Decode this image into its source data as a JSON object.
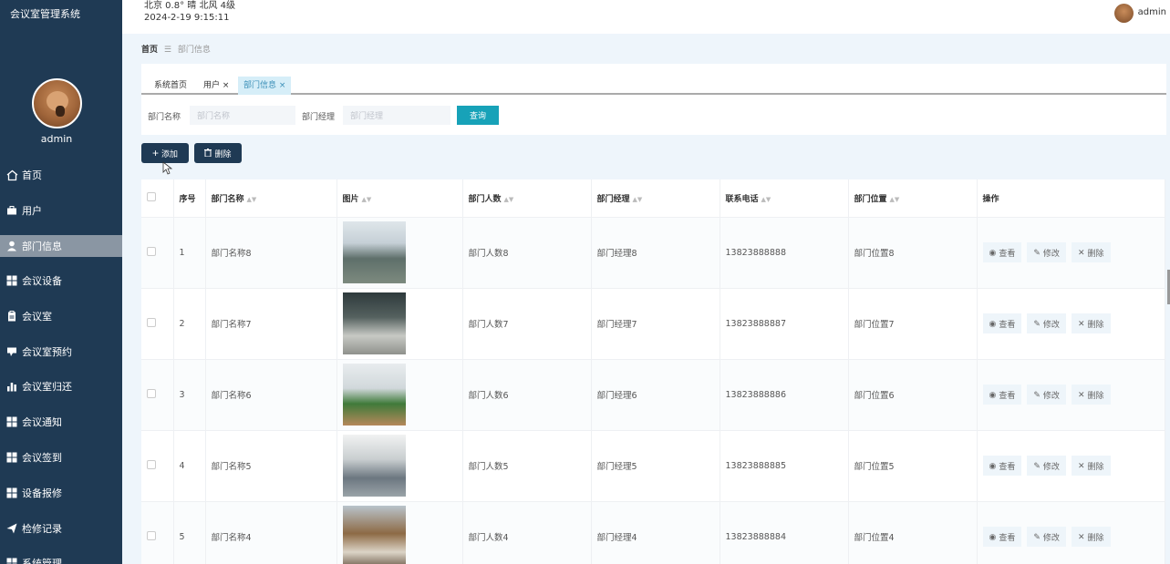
{
  "app": {
    "title": "会议室管理系统"
  },
  "sidebar": {
    "username": "admin",
    "items": [
      {
        "label": "首页",
        "icon": "home-icon"
      },
      {
        "label": "用户",
        "icon": "briefcase-icon"
      },
      {
        "label": "部门信息",
        "icon": "user-icon",
        "active": true
      },
      {
        "label": "会议设备",
        "icon": "grid-icon"
      },
      {
        "label": "会议室",
        "icon": "clipboard-icon"
      },
      {
        "label": "会议室预约",
        "icon": "comment-icon"
      },
      {
        "label": "会议室归还",
        "icon": "bar-chart-icon"
      },
      {
        "label": "会议通知",
        "icon": "grid-icon"
      },
      {
        "label": "会议签到",
        "icon": "grid-icon"
      },
      {
        "label": "设备报修",
        "icon": "grid-icon"
      },
      {
        "label": "检修记录",
        "icon": "send-icon"
      },
      {
        "label": "系统管理",
        "icon": "grid-icon"
      }
    ]
  },
  "topbar": {
    "weather_line": "北京  0.8°  晴  北风  4级",
    "datetime": "2024-2-19 9:15:11",
    "username": "admin"
  },
  "breadcrumb": {
    "home": "首页",
    "separator": "☰",
    "current": "部门信息"
  },
  "tabs": [
    {
      "label": "系统首页",
      "closable": false,
      "active": false
    },
    {
      "label": "用户",
      "closable": true,
      "active": false
    },
    {
      "label": "部门信息",
      "closable": true,
      "active": true
    }
  ],
  "tab_close_glyph": "×",
  "search": {
    "dept_name_label": "部门名称",
    "dept_name_placeholder": "部门名称",
    "dept_manager_label": "部门经理",
    "dept_manager_placeholder": "部门经理",
    "query_button": "查询"
  },
  "actions": {
    "add": "添加",
    "delete": "删除"
  },
  "table": {
    "columns": [
      "",
      "序号",
      "部门名称",
      "图片",
      "部门人数",
      "部门经理",
      "联系电话",
      "部门位置",
      "操作"
    ],
    "sortable": [
      false,
      false,
      true,
      true,
      true,
      true,
      true,
      true,
      false
    ],
    "rows": [
      {
        "index": "1",
        "name": "部门名称8",
        "count": "部门人数8",
        "manager": "部门经理8",
        "phone": "13823888888",
        "location": "部门位置8"
      },
      {
        "index": "2",
        "name": "部门名称7",
        "count": "部门人数7",
        "manager": "部门经理7",
        "phone": "13823888887",
        "location": "部门位置7"
      },
      {
        "index": "3",
        "name": "部门名称6",
        "count": "部门人数6",
        "manager": "部门经理6",
        "phone": "13823888886",
        "location": "部门位置6"
      },
      {
        "index": "4",
        "name": "部门名称5",
        "count": "部门人数5",
        "manager": "部门经理5",
        "phone": "13823888885",
        "location": "部门位置5"
      },
      {
        "index": "5",
        "name": "部门名称4",
        "count": "部门人数4",
        "manager": "部门经理4",
        "phone": "13823888884",
        "location": "部门位置4"
      }
    ],
    "row_actions": {
      "view": "查看",
      "edit": "修改",
      "delete": "删除"
    }
  },
  "colors": {
    "sidebar_bg": "#1f3a54",
    "accent": "#17a2b8",
    "active_tab_bg": "#d6eef8"
  }
}
